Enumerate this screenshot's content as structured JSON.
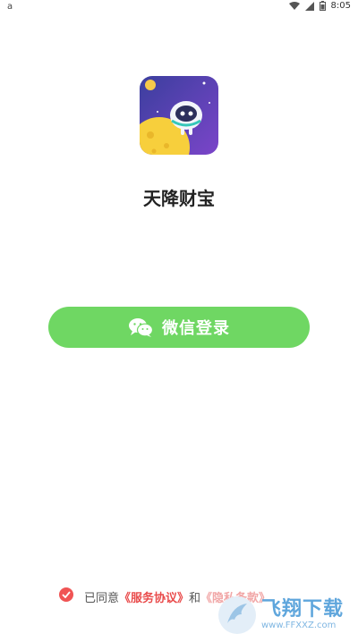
{
  "status_bar": {
    "left_icon": "a",
    "time": "8:05",
    "icons": [
      "wifi-icon",
      "signal-icon",
      "battery-icon"
    ]
  },
  "app": {
    "name": "天降财宝",
    "icon": "robot-on-moon-icon"
  },
  "login": {
    "button_label": "微信登录",
    "icon": "wechat-icon",
    "color": "#6fd763"
  },
  "agreement": {
    "prefix": "已同意",
    "service_link": "《服务协议》",
    "and": "和",
    "privacy_link": "《隐私条款》"
  },
  "watermark": {
    "brand": "飞翔下载",
    "url": "www.FFXXZ.com"
  }
}
